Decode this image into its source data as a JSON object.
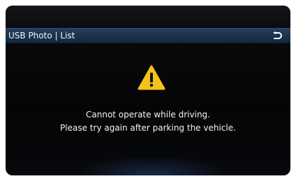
{
  "header": {
    "title": "USB Photo | List",
    "back_icon": "back-arrow-icon"
  },
  "dialog": {
    "icon": "warning-icon",
    "icon_color": "#f6c21a",
    "message_line1": "Cannot operate while driving.",
    "message_line2": "Please try again after parking the vehicle."
  },
  "colors": {
    "header_bar": "#1c3550",
    "background": "#060709",
    "text": "#f4f4f4"
  }
}
